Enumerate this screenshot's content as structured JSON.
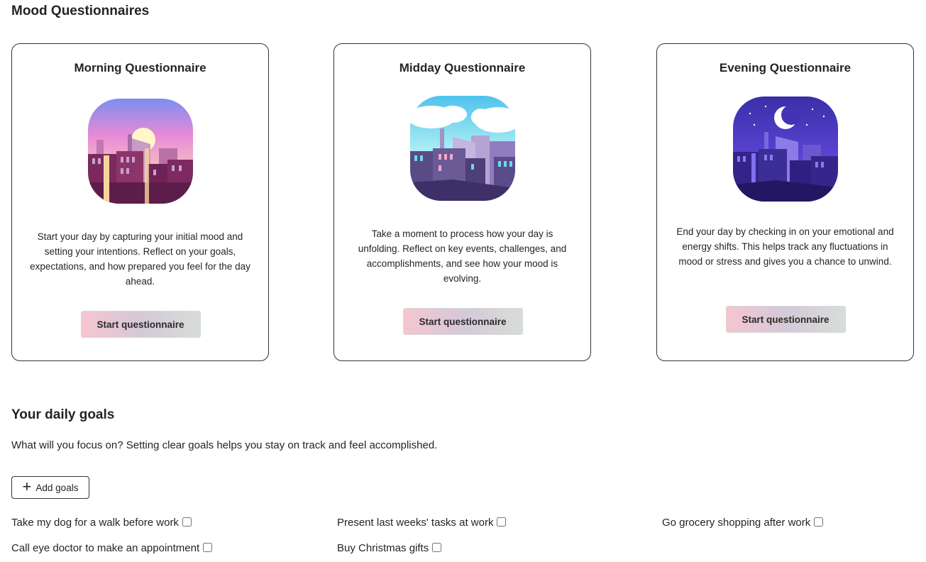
{
  "mood": {
    "title": "Mood Questionnaires",
    "cards": [
      {
        "title": "Morning Questionnaire",
        "image": "morning-city-icon",
        "description": "Start your day by capturing your initial mood and setting your intentions. Reflect on your goals, expectations, and how prepared you feel for the day ahead.",
        "button": "Start questionnaire"
      },
      {
        "title": "Midday Questionnaire",
        "image": "midday-city-icon",
        "description": "Take a moment to process how your day is unfolding. Reflect on key events, challenges, and accomplishments, and see how your mood is evolving.",
        "button": "Start questionnaire"
      },
      {
        "title": "Evening Questionnaire",
        "image": "evening-city-icon",
        "description": "End your day by checking in on your emotional and energy shifts. This helps track any fluctuations in mood or stress and gives you a chance to unwind.",
        "button": "Start questionnaire"
      }
    ]
  },
  "goals": {
    "title": "Your daily goals",
    "description": "What will you focus on? Setting clear goals helps you stay on track and feel accomplished.",
    "add_button": "Add goals",
    "add_icon": "+",
    "items": [
      {
        "label": "Take my dog for a walk before work",
        "checked": false
      },
      {
        "label": "Present last weeks' tasks at work",
        "checked": false
      },
      {
        "label": "Go grocery shopping after work",
        "checked": false
      },
      {
        "label": "Call eye doctor to make an appointment",
        "checked": false
      },
      {
        "label": "Buy Christmas gifts",
        "checked": false
      }
    ]
  },
  "colors": {
    "border": "#333333",
    "button_gradient": [
      "#f6c5d0",
      "#d4c9d8",
      "#d7ddd9"
    ]
  }
}
